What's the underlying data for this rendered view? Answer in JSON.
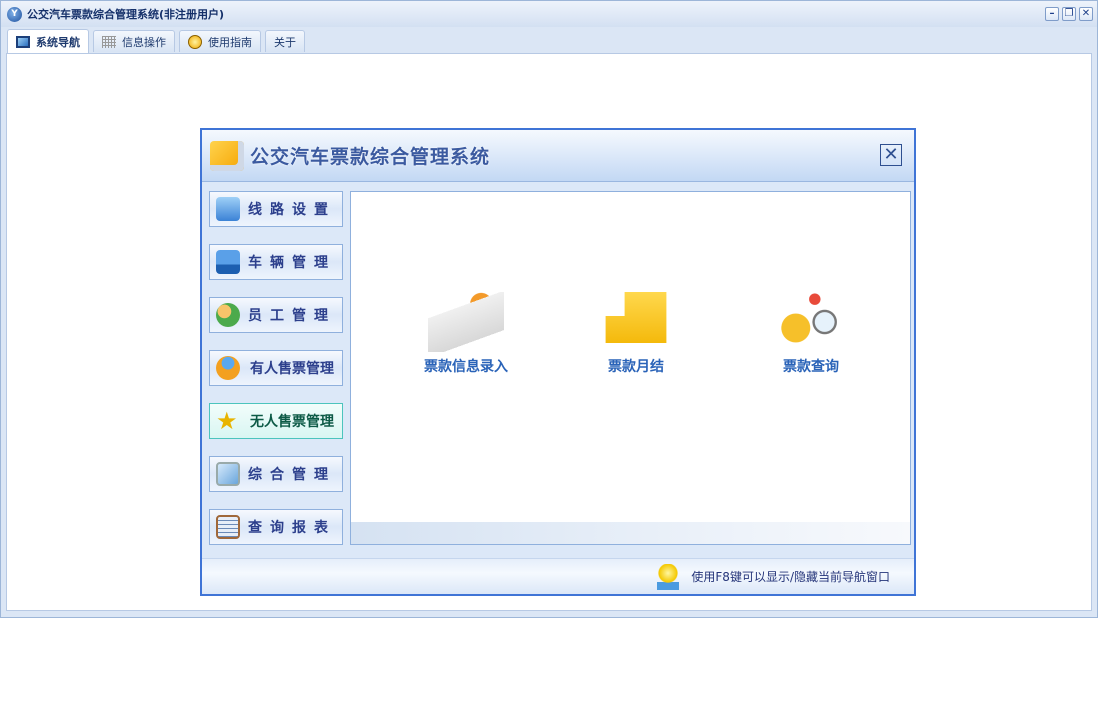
{
  "window": {
    "title": "公交汽车票款综合管理系统(非注册用户)",
    "controls": [
      "minimize",
      "restore",
      "close"
    ]
  },
  "tabs": [
    {
      "label": "系统导航",
      "icon": "monitor-icon",
      "active": true
    },
    {
      "label": "信息操作",
      "icon": "grid-icon"
    },
    {
      "label": "使用指南",
      "icon": "help-icon"
    },
    {
      "label": "关于"
    }
  ],
  "dialog": {
    "title": "公交汽车票款综合管理系统",
    "nav": [
      {
        "label": "线路设置",
        "icon": "route-icon"
      },
      {
        "label": "车辆管理",
        "icon": "bus-icon"
      },
      {
        "label": "员工管理",
        "icon": "staff-icon"
      },
      {
        "label": "有人售票管理",
        "icon": "user-ticket-icon"
      },
      {
        "label": "无人售票管理",
        "icon": "star-icon",
        "selected": true
      },
      {
        "label": "综合管理",
        "icon": "computer-icon"
      },
      {
        "label": "查询报表",
        "icon": "report-book-icon"
      }
    ],
    "functions": [
      {
        "label": "票款信息录入",
        "icon": "document-entry-icon"
      },
      {
        "label": "票款月结",
        "icon": "gold-stack-icon"
      },
      {
        "label": "票款查询",
        "icon": "coins-search-icon"
      }
    ],
    "footer_hint": "使用F8键可以显示/隐藏当前导航窗口"
  },
  "colors": {
    "accent": "#3f74d6",
    "nav_text": "#2c3f8c",
    "function_text": "#2a63b8",
    "selected_nav": "#0d5a46"
  }
}
